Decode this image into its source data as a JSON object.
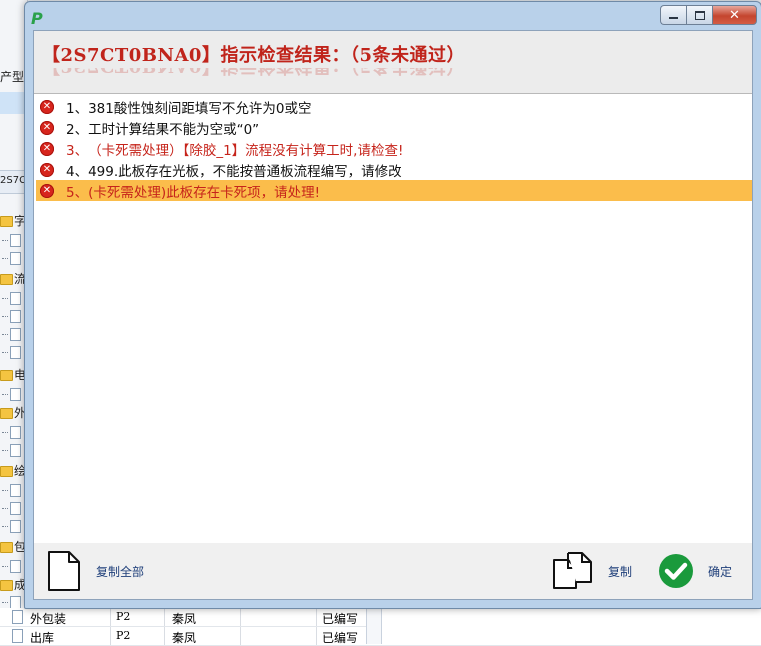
{
  "background": {
    "left_labels": [
      "产型",
      "2S7C"
    ],
    "tree_chars": [
      "字",
      "流",
      "电",
      "外",
      "绘",
      "包",
      "成"
    ],
    "rows": [
      {
        "name": "外包装",
        "code": "P2",
        "person": "秦凤",
        "status": "已编写"
      },
      {
        "name": "出库",
        "code": "P2",
        "person": "秦凤",
        "status": "已编写"
      }
    ]
  },
  "dialog": {
    "app_icon": "P",
    "window_buttons": {
      "minimize_icon": "minimize-icon",
      "maximize_icon": "maximize-icon",
      "close_symbol": "✕"
    },
    "header_title": "【2S7CT0BNA0】指示检查结果：（5条未通过）",
    "results": [
      {
        "index": "1、",
        "text": "381酸性蚀刻间距填写不允许为0或空",
        "color": "black",
        "selected": false
      },
      {
        "index": "2、",
        "text": "工时计算结果不能为空或“0”",
        "color": "black",
        "selected": false
      },
      {
        "index": "3、",
        "text": "（卡死需处理）【除胶_1】流程没有计算工时,请检查!",
        "color": "red",
        "selected": false
      },
      {
        "index": "4、",
        "text": "499.此板存在光板，不能按普通板流程编写，请修改",
        "color": "black",
        "selected": false
      },
      {
        "index": "5、",
        "text": "(卡死需处理)此板存在卡死项，请处理!",
        "color": "red",
        "selected": true
      }
    ],
    "footer": {
      "copy_all_label": "复制全部",
      "copy_label": "复制",
      "ok_label": "确定"
    }
  },
  "colors": {
    "error_red": "#c6241b",
    "selection": "#fbbd4b",
    "ok_green": "#1a9a3c",
    "title_red": "#c0241b"
  }
}
